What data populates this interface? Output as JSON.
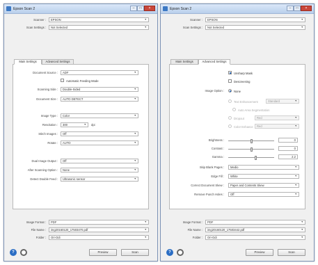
{
  "left_window": {
    "title": "Epson Scan 2",
    "header": {
      "scanner_label": "Scanner :",
      "scanner_value": "EPSON",
      "scan_settings_label": "Scan Settings :",
      "scan_settings_value": "Not Selected"
    },
    "tabs": [
      "Main Settings",
      "Advanced Settings"
    ],
    "active_tab": 0,
    "main": {
      "document_source_label": "Document Source :",
      "document_source_value": "ADF",
      "auto_feeding_label": "Automatic Feeding Mode",
      "scanning_side_label": "Scanning Side :",
      "scanning_side_value": "Double-Sided",
      "document_size_label": "Document Size :",
      "document_size_value": "AUTO DETECT",
      "image_type_label": "Image Type :",
      "image_type_value": "Color",
      "resolution_label": "Resolution :",
      "resolution_value": "300",
      "resolution_unit": "dpi",
      "stitch_label": "Stitch Images :",
      "stitch_value": "Off",
      "rotate_label": "Rotate :",
      "rotate_value": "AUTO",
      "dual_label": "Dual Image Output :",
      "dual_value": "Off",
      "after_label": "After Scanning Option :",
      "after_value": "None",
      "detect_label": "Detect Double Feed :",
      "detect_value": "Ultrasonic sensor"
    },
    "footer": {
      "image_format_label": "Image Format :",
      "image_format_value": "PDF",
      "file_name_label": "File Name :",
      "file_name_value": "img20160120_17503470.pdf",
      "folder_label": "Folder :",
      "folder_value": "Ori-Odi",
      "help_icon_glyph": "?",
      "preview_label": "Preview",
      "scan_label": "Scan"
    }
  },
  "right_window": {
    "title": "Epson Scan 2",
    "header": {
      "scanner_label": "Scanner :",
      "scanner_value": "EPSON",
      "scan_settings_label": "Scan Settings :",
      "scan_settings_value": "Not Selected"
    },
    "tabs": [
      "Main Settings",
      "Advanced Settings"
    ],
    "active_tab": 1,
    "advanced": {
      "unsharp_label": "Unsharp Mask",
      "unsharp_checked": true,
      "descreening_label": "Descreening",
      "descreening_checked": false,
      "image_option_label": "Image Option :",
      "opt_none": "None",
      "opt_text_enhancement": "Text Enhancement",
      "text_enhancement_value": "Standard",
      "opt_auto_area": "Auto Area Segmentation",
      "opt_dropout": "Dropout",
      "dropout_value": "Red",
      "opt_color_enhance": "Color Enhance",
      "color_enhance_value": "Red",
      "brightness_label": "Brightness :",
      "brightness_value": "0",
      "brightness_level": 0.5,
      "contrast_label": "Contrast :",
      "contrast_value": "0",
      "contrast_level": 0.5,
      "gamma_label": "Gamma :",
      "gamma_value": "2.2",
      "gamma_level": 0.6,
      "skip_label": "Skip Blank Pages :",
      "skip_value": "Medio",
      "edge_label": "Edge Fill :",
      "edge_value": "White",
      "correct_label": "Correct Document Skew :",
      "correct_value": "Paper and Contents Skew",
      "punch_label": "Remove Punch Holes :",
      "punch_value": "Off"
    },
    "footer": {
      "image_format_label": "Image Format :",
      "image_format_value": "PDF",
      "file_name_label": "File Name :",
      "file_name_value": "img20160120_17503442.pdf",
      "folder_label": "Folder :",
      "folder_value": "Ori-Odi",
      "help_icon_glyph": "?",
      "preview_label": "Preview",
      "scan_label": "Scan"
    }
  }
}
